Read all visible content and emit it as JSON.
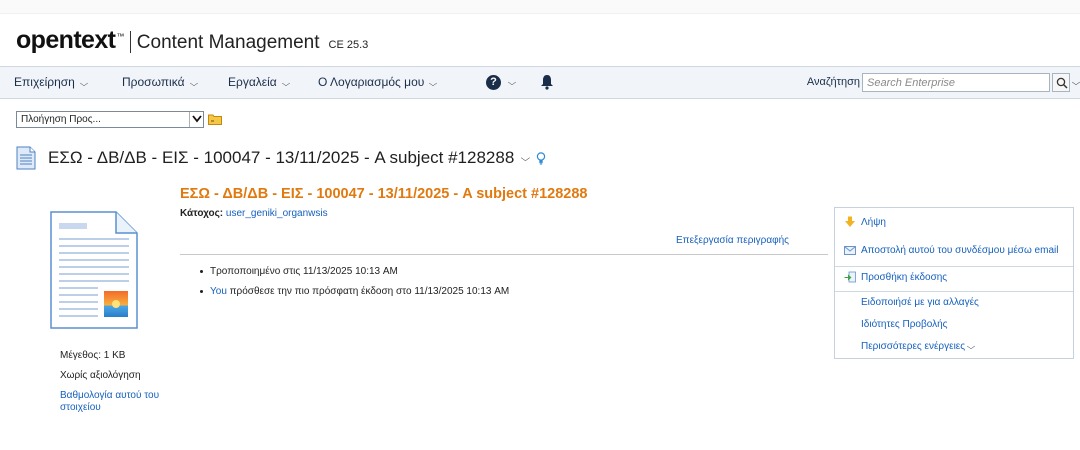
{
  "brand": {
    "logo": "opentext",
    "trademark": "™",
    "product": "Content Management",
    "version": "CE 25.3"
  },
  "nav": {
    "items": [
      {
        "label": "Επιχείρηση"
      },
      {
        "label": "Προσωπικά"
      },
      {
        "label": "Εργαλεία"
      },
      {
        "label": "Ο Λογαριασμός μου"
      }
    ],
    "help_glyph": "?",
    "search_label": "Αναζήτηση",
    "search_placeholder": "Search Enterprise"
  },
  "goto": {
    "selected": "Πλοήγηση Προς..."
  },
  "page": {
    "title": "ΕΣΩ - ΔΒ/ΔΒ - ΕΙΣ - 100047 - 13/11/2025 - A subject #128288"
  },
  "document": {
    "heading": "ΕΣΩ - ΔΒ/ΔΒ - ΕΙΣ - 100047 - 13/11/2025 - A subject #128288",
    "owner_label": "Κάτοχος:",
    "owner_value": "user_geniki_organwsis",
    "edit_description": "Επεξεργασία περιγραφής",
    "size": "Μέγεθος: 1 KB",
    "rating": "Χωρίς αξιολόγηση",
    "rate_link": "Βαθμολογία αυτού του στοιχείου"
  },
  "activity": [
    {
      "text": "Τροποποιημένο στις 11/13/2025 10:13 AM"
    },
    {
      "user": "You",
      "text": " πρόσθεσε την πιο πρόσφατη έκδοση στο 11/13/2025 10:13 AM"
    }
  ],
  "actions": [
    {
      "label": "Λήψη",
      "icon": "download-icon"
    },
    {
      "label": "Αποστολή αυτού του συνδέσμου μέσω email",
      "icon": "email-icon"
    },
    {
      "label": "Προσθήκη έκδοσης",
      "icon": "add-version-icon"
    },
    {
      "label": "Ειδοποιήσέ με για αλλαγές"
    },
    {
      "label": "Ιδιότητες Προβολής"
    },
    {
      "label": "Περισσότερες ενέργειες"
    }
  ],
  "colors": {
    "accent_orange": "#e07a10",
    "link_blue": "#1560bd",
    "nav_bg": "#f1f5f9"
  }
}
